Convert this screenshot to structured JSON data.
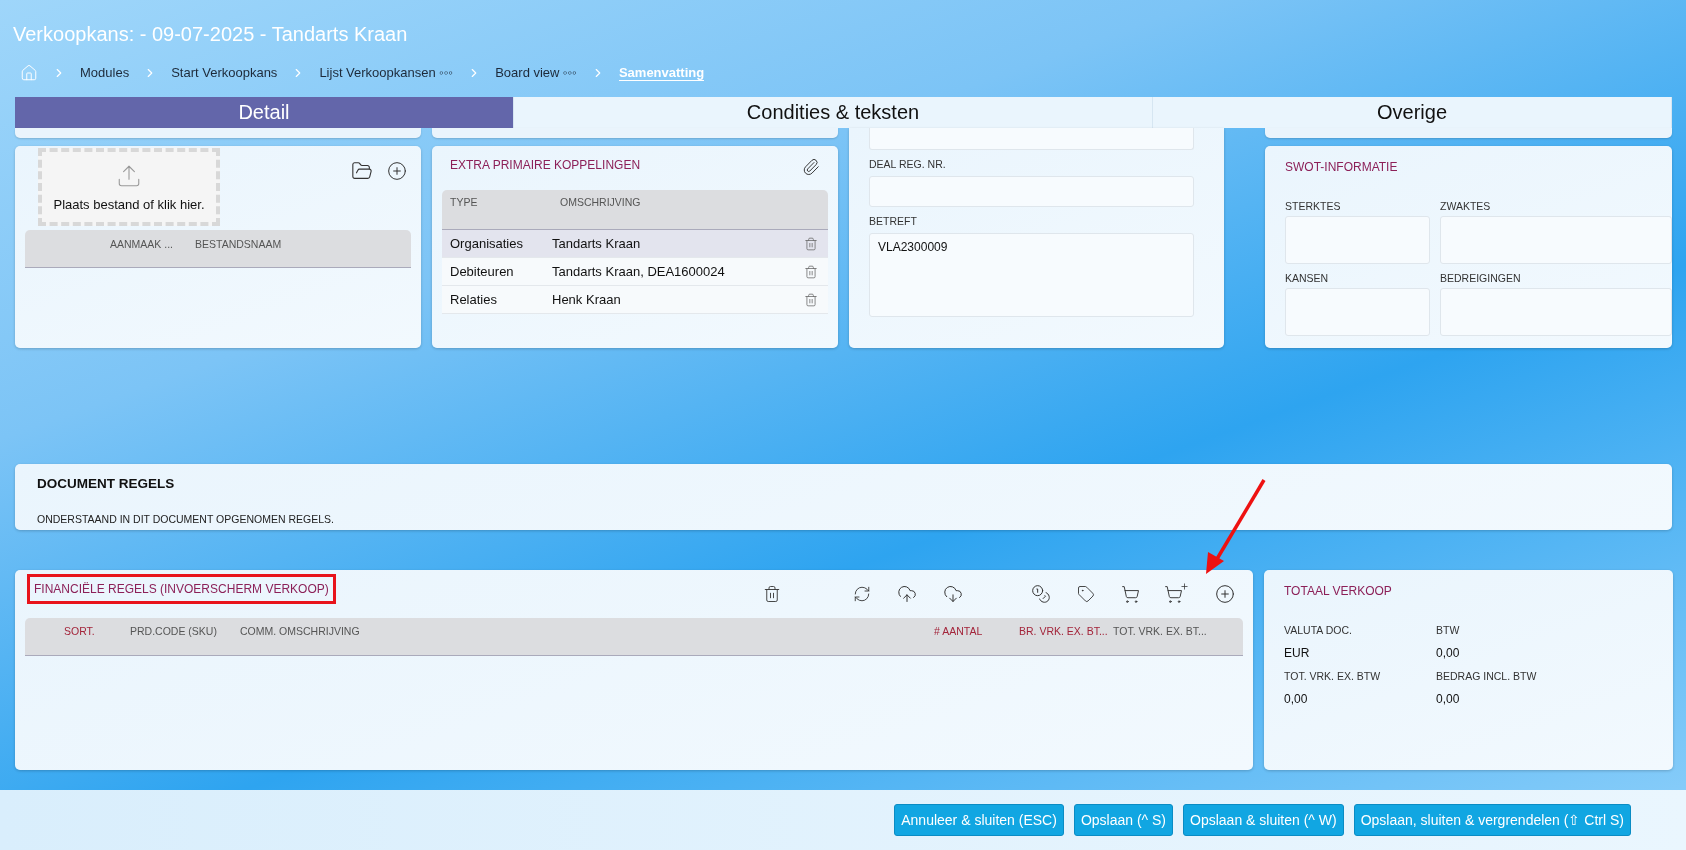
{
  "title": "Verkoopkans: - 09-07-2025 - Tandarts Kraan",
  "breadcrumb": [
    {
      "label": "Modules",
      "selected": false
    },
    {
      "label": "Start Verkoopkans",
      "selected": false
    },
    {
      "label": "Lijst Verkoopkansen ◦◦◦",
      "selected": false
    },
    {
      "label": "Board view ◦◦◦",
      "selected": false
    },
    {
      "label": "Samenvatting",
      "selected": true
    }
  ],
  "tabs": [
    {
      "label": "Detail",
      "selected": true
    },
    {
      "label": "Condities & teksten",
      "selected": false
    },
    {
      "label": "Overige",
      "selected": false
    }
  ],
  "upload": {
    "dropzone_text": "Plaats bestand of klik hier.",
    "columns": [
      "AANMAAK ...",
      "BESTANDSNAAM"
    ]
  },
  "links": {
    "title": "EXTRA PRIMAIRE KOPPELINGEN",
    "columns": [
      "TYPE",
      "OMSCHRIJVING"
    ],
    "rows": [
      {
        "type": "Organisaties",
        "description": "Tandarts Kraan",
        "selected": true
      },
      {
        "type": "Debiteuren",
        "description": "Tandarts Kraan, DEA1600024",
        "selected": false
      },
      {
        "type": "Relaties",
        "description": "Henk Kraan",
        "selected": false
      }
    ]
  },
  "deal": {
    "fields": [
      {
        "kind": "input"
      },
      {
        "kind": "input",
        "label": "DEAL REG. NR."
      },
      {
        "kind": "textarea",
        "label": "BETREFT",
        "value": "VLA2300009"
      }
    ]
  },
  "swot": {
    "title": "SWOT-INFORMATIE",
    "fields": [
      {
        "label": "STERKTES"
      },
      {
        "label": "ZWAKTES"
      },
      {
        "label": "KANSEN"
      },
      {
        "label": "BEDREIGINGEN"
      }
    ]
  },
  "document_rules": {
    "title": "DOCUMENT REGELS",
    "description": "ONDERSTAAND IN DIT DOCUMENT OPGENOMEN REGELS."
  },
  "financial": {
    "title": "FINANCIËLE REGELS (INVOERSCHERM VERKOOP)",
    "highlighted": true,
    "pointer_arrow": true,
    "columns": [
      {
        "label": "SORT.",
        "accent": true
      },
      {
        "label": "PRD.CODE (SKU)",
        "accent": false
      },
      {
        "label": "COMM. OMSCHRIJVING",
        "accent": false
      },
      {
        "label": "# AANTAL",
        "accent": true
      },
      {
        "label": "BR. VRK. EX. BT...",
        "accent": true
      },
      {
        "label": "TOT. VRK. EX. BT...",
        "accent": false
      }
    ]
  },
  "totals": {
    "title": "TOTAAL VERKOOP",
    "items": [
      {
        "label": "VALUTA DOC.",
        "value": "EUR"
      },
      {
        "label": "BTW",
        "value": "0,00"
      },
      {
        "label": "TOT. VRK. EX. BTW",
        "value": "0,00"
      },
      {
        "label": "BEDRAG INCL. BTW",
        "value": "0,00"
      }
    ]
  },
  "buttons": [
    "Annuleer & sluiten (ESC)",
    "Opslaan (^ S)",
    "Opslaan & sluiten (^ W)",
    "Opslaan, sluiten & vergrendelen (⇧ Ctrl S)"
  ]
}
